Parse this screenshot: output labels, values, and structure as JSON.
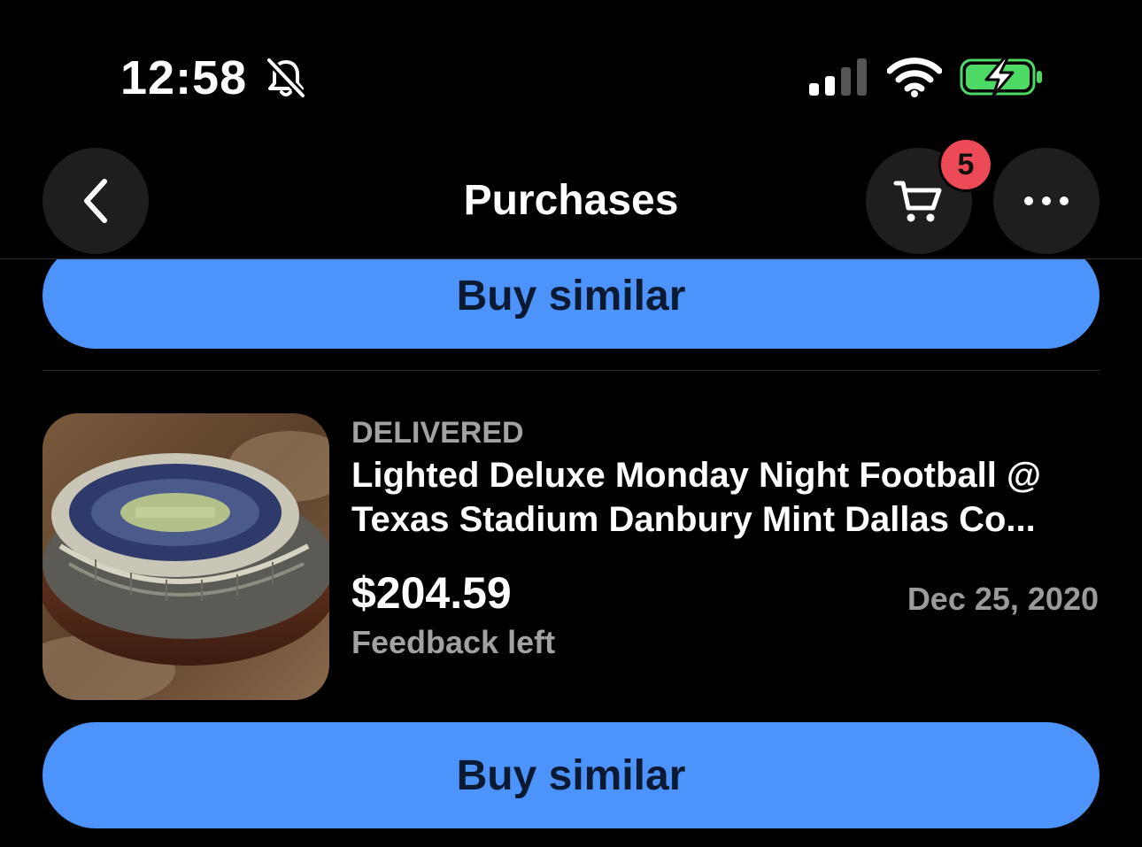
{
  "status_bar": {
    "time": "12:58"
  },
  "header": {
    "title": "Purchases",
    "cart_count": "5"
  },
  "actions": {
    "buy_similar_label": "Buy similar"
  },
  "item": {
    "status": "DELIVERED",
    "title": "Lighted Deluxe Monday Night Football @ Texas Stadium Danbury Mint Dallas Co...",
    "price": "$204.59",
    "date": "Dec 25, 2020",
    "feedback": "Feedback left"
  },
  "colors": {
    "accent_button": "#4c93fb",
    "badge": "#ec4a57",
    "battery": "#4cd964"
  }
}
